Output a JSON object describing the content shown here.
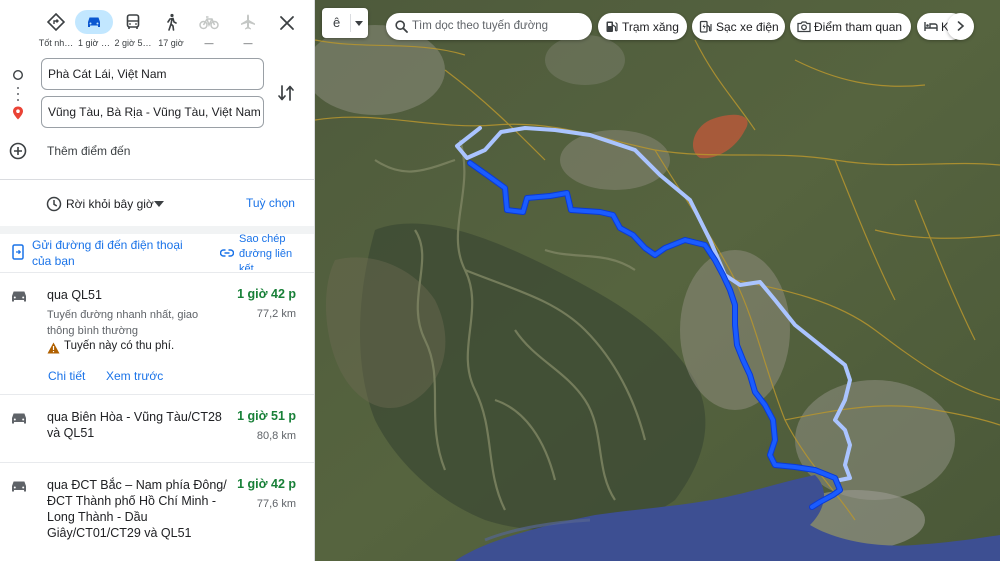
{
  "travel_modes": [
    {
      "name": "best",
      "label": "Tốt nh…",
      "active": false
    },
    {
      "name": "driving",
      "label": "1 giờ …",
      "active": true
    },
    {
      "name": "transit",
      "label": "2 giờ 5…",
      "active": false
    },
    {
      "name": "walking",
      "label": "17 giờ",
      "active": false
    },
    {
      "name": "cycling",
      "label": "—",
      "active": false
    },
    {
      "name": "flight",
      "label": "—",
      "active": false
    }
  ],
  "origin": "Phà Cát Lái, Việt Nam",
  "destination": "Vũng Tàu, Bà Rịa - Vũng Tàu, Việt Nam",
  "add_destination": "Thêm điểm đến",
  "depart_label": "Rời khỏi bây giờ",
  "options_label": "Tuỳ chọn",
  "send_to_phone": "Gửi đường đi đến điện thoại của bạn",
  "copy_link": "Sao chép đường liên kết",
  "routes": [
    {
      "title": "qua QL51",
      "time": "1 giờ 42 p",
      "distance": "77,2 km",
      "description": "Tuyến đường nhanh nhất, giao thông bình thường",
      "warning": "Tuyến này có thu phí.",
      "details_link": "Chi tiết",
      "preview_link": "Xem trước"
    },
    {
      "title": "qua Biên Hòa - Vũng Tàu/CT28 và QL51",
      "time": "1 giờ 51 p",
      "distance": "80,8 km"
    },
    {
      "title": "qua ĐCT Bắc – Nam phía Đông/ĐCT Thành phố Hồ Chí Minh - Long Thành - Dầu Giây/CT01/CT29 và QL51",
      "time": "1 giờ 42 p",
      "distance": "77,6 km"
    }
  ],
  "map": {
    "search_placeholder": "Tìm dọc theo tuyến đường",
    "layer_label": "ê",
    "chips": [
      {
        "name": "gas",
        "label": "Trạm xăng"
      },
      {
        "name": "ev",
        "label": "Sạc xe điện"
      },
      {
        "name": "attractions",
        "label": "Điểm tham quan"
      },
      {
        "name": "hotels",
        "label": "Khách sạn"
      }
    ],
    "primary_route_color": "#1a5cff",
    "alt_route_color": "#aac4ff"
  },
  "colors": {
    "accent": "#1a73e8",
    "time_green": "#188038",
    "active_mode": "#c2e7ff"
  }
}
